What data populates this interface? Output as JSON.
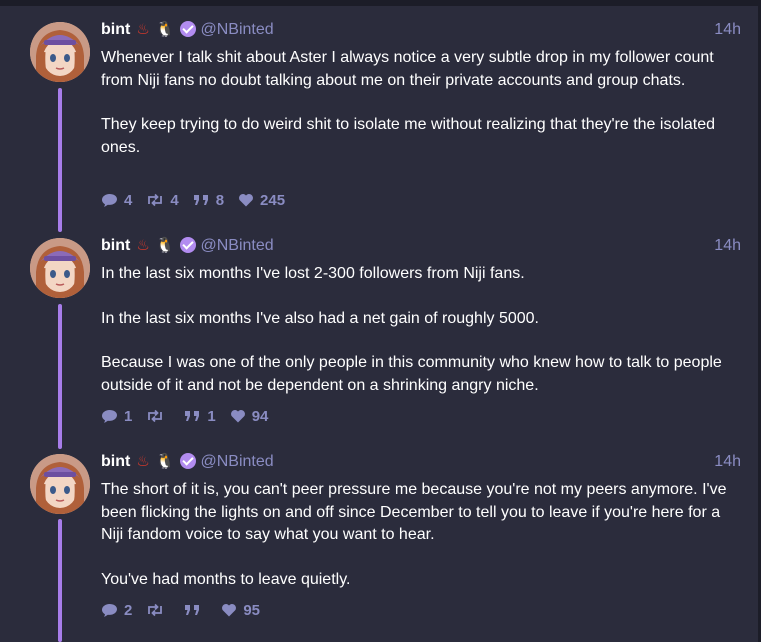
{
  "posts": [
    {
      "name": "bint",
      "emojis": [
        "♨",
        "🐧"
      ],
      "handle": "@NBinted",
      "time": "14h",
      "paragraphs": [
        "Whenever I talk shit about Aster I always notice a very subtle drop in my follower count from Niji fans no doubt talking about me on their private accounts and group chats.",
        "They keep trying to do weird shit to isolate me without realizing that they're the isolated ones."
      ],
      "replies": "4",
      "reposts": "4",
      "quotes": "8",
      "likes": "245"
    },
    {
      "name": "bint",
      "emojis": [
        "♨",
        "🐧"
      ],
      "handle": "@NBinted",
      "time": "14h",
      "paragraphs": [
        "In the last six months I've lost 2-300 followers from Niji fans.",
        "In the last six months I've also had a net gain of roughly 5000.",
        "Because I was one of the only people in this community who knew how to talk to people outside of it and not be dependent on a shrinking angry niche."
      ],
      "replies": "1",
      "reposts": "",
      "quotes": "1",
      "likes": "94"
    },
    {
      "name": "bint",
      "emojis": [
        "♨",
        "🐧"
      ],
      "handle": "@NBinted",
      "time": "14h",
      "paragraphs": [
        "The short of it is, you can't peer pressure me because you're not my peers anymore. I've been flicking the lights on and off since December to tell you to leave if you're here for a Niji fandom voice to say what you want to hear.",
        "You've had months to leave quietly."
      ],
      "replies": "2",
      "reposts": "",
      "quotes": "",
      "likes": "95"
    }
  ],
  "icons": {
    "reply": "reply-icon",
    "repost": "repost-icon",
    "quote": "quote-icon",
    "like": "like-icon",
    "verified": "verified-icon"
  },
  "colors": {
    "background": "#2b2c3c",
    "accent": "#a77de9",
    "muted": "#8a8cc2"
  }
}
